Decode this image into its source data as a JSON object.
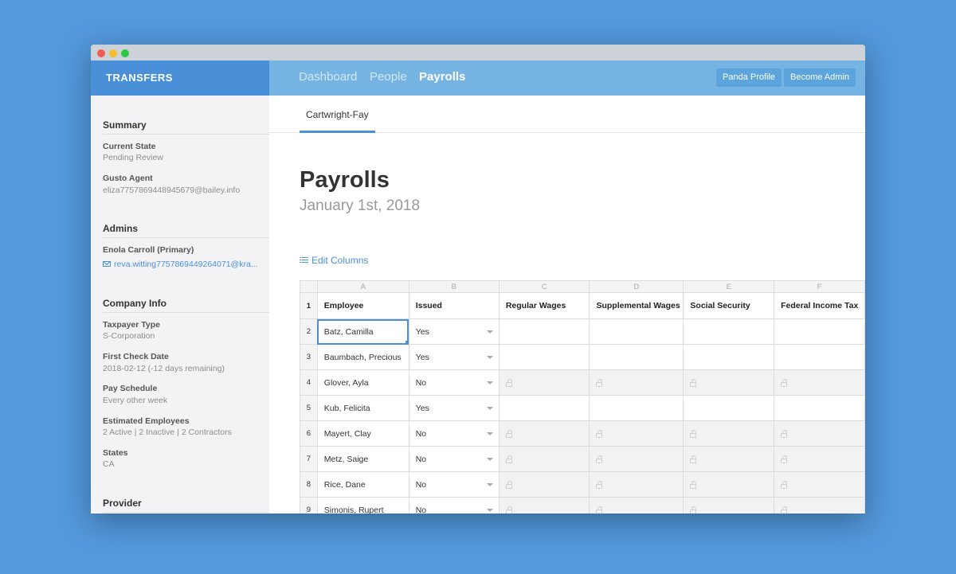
{
  "app": {
    "brand": "TRANSFERS"
  },
  "nav": {
    "items": [
      {
        "label": "Dashboard",
        "active": false
      },
      {
        "label": "People",
        "active": false
      },
      {
        "label": "Payrolls",
        "active": true
      }
    ],
    "buttons": [
      "Panda Profile",
      "Become Admin"
    ]
  },
  "sidebar": {
    "summary": {
      "heading": "Summary",
      "current_state_label": "Current State",
      "current_state_value": "Pending Review",
      "agent_label": "Gusto Agent",
      "agent_value": "eliza7757869448945679@bailey.info"
    },
    "admins": {
      "heading": "Admins",
      "name": "Enola Carroll (Primary)",
      "email": "reva.witting7757869449264071@kra..."
    },
    "company": {
      "heading": "Company Info",
      "taxpayer_label": "Taxpayer Type",
      "taxpayer_value": "S-Corporation",
      "first_check_label": "First Check Date",
      "first_check_value": "2018-02-12 (-12 days remaining)",
      "pay_schedule_label": "Pay Schedule",
      "pay_schedule_value": "Every other week",
      "employees_label": "Estimated Employees",
      "employees_value": "2 Active | 2 Inactive | 2 Contractors",
      "states_label": "States",
      "states_value": "CA"
    },
    "provider": {
      "heading": "Provider"
    }
  },
  "main": {
    "tab": "Cartwright-Fay",
    "title": "Payrolls",
    "subtitle": "January 1st, 2018",
    "edit_columns": "Edit Columns"
  },
  "grid": {
    "col_letters": [
      "A",
      "B",
      "C",
      "D",
      "E",
      "F"
    ],
    "headers": [
      "Employee",
      "Issued",
      "Regular Wages",
      "Supplemental Wages",
      "Social Security",
      "Federal Income Tax"
    ],
    "rows": [
      {
        "num": "2",
        "employee": "Batz, Camilla",
        "issued": "Yes"
      },
      {
        "num": "3",
        "employee": "Baumbach, Precious",
        "issued": "Yes"
      },
      {
        "num": "4",
        "employee": "Glover, Ayla",
        "issued": "No"
      },
      {
        "num": "5",
        "employee": "Kub, Felicita",
        "issued": "Yes"
      },
      {
        "num": "6",
        "employee": "Mayert, Clay",
        "issued": "No"
      },
      {
        "num": "7",
        "employee": "Metz, Saige",
        "issued": "No"
      },
      {
        "num": "8",
        "employee": "Rice, Dane",
        "issued": "No"
      },
      {
        "num": "9",
        "employee": "Simonis, Rupert",
        "issued": "No"
      }
    ],
    "header_row_num": "1"
  },
  "colors": {
    "accent": "#4a90d9",
    "nav_bg": "#76b5e3",
    "background": "#5399dd"
  }
}
